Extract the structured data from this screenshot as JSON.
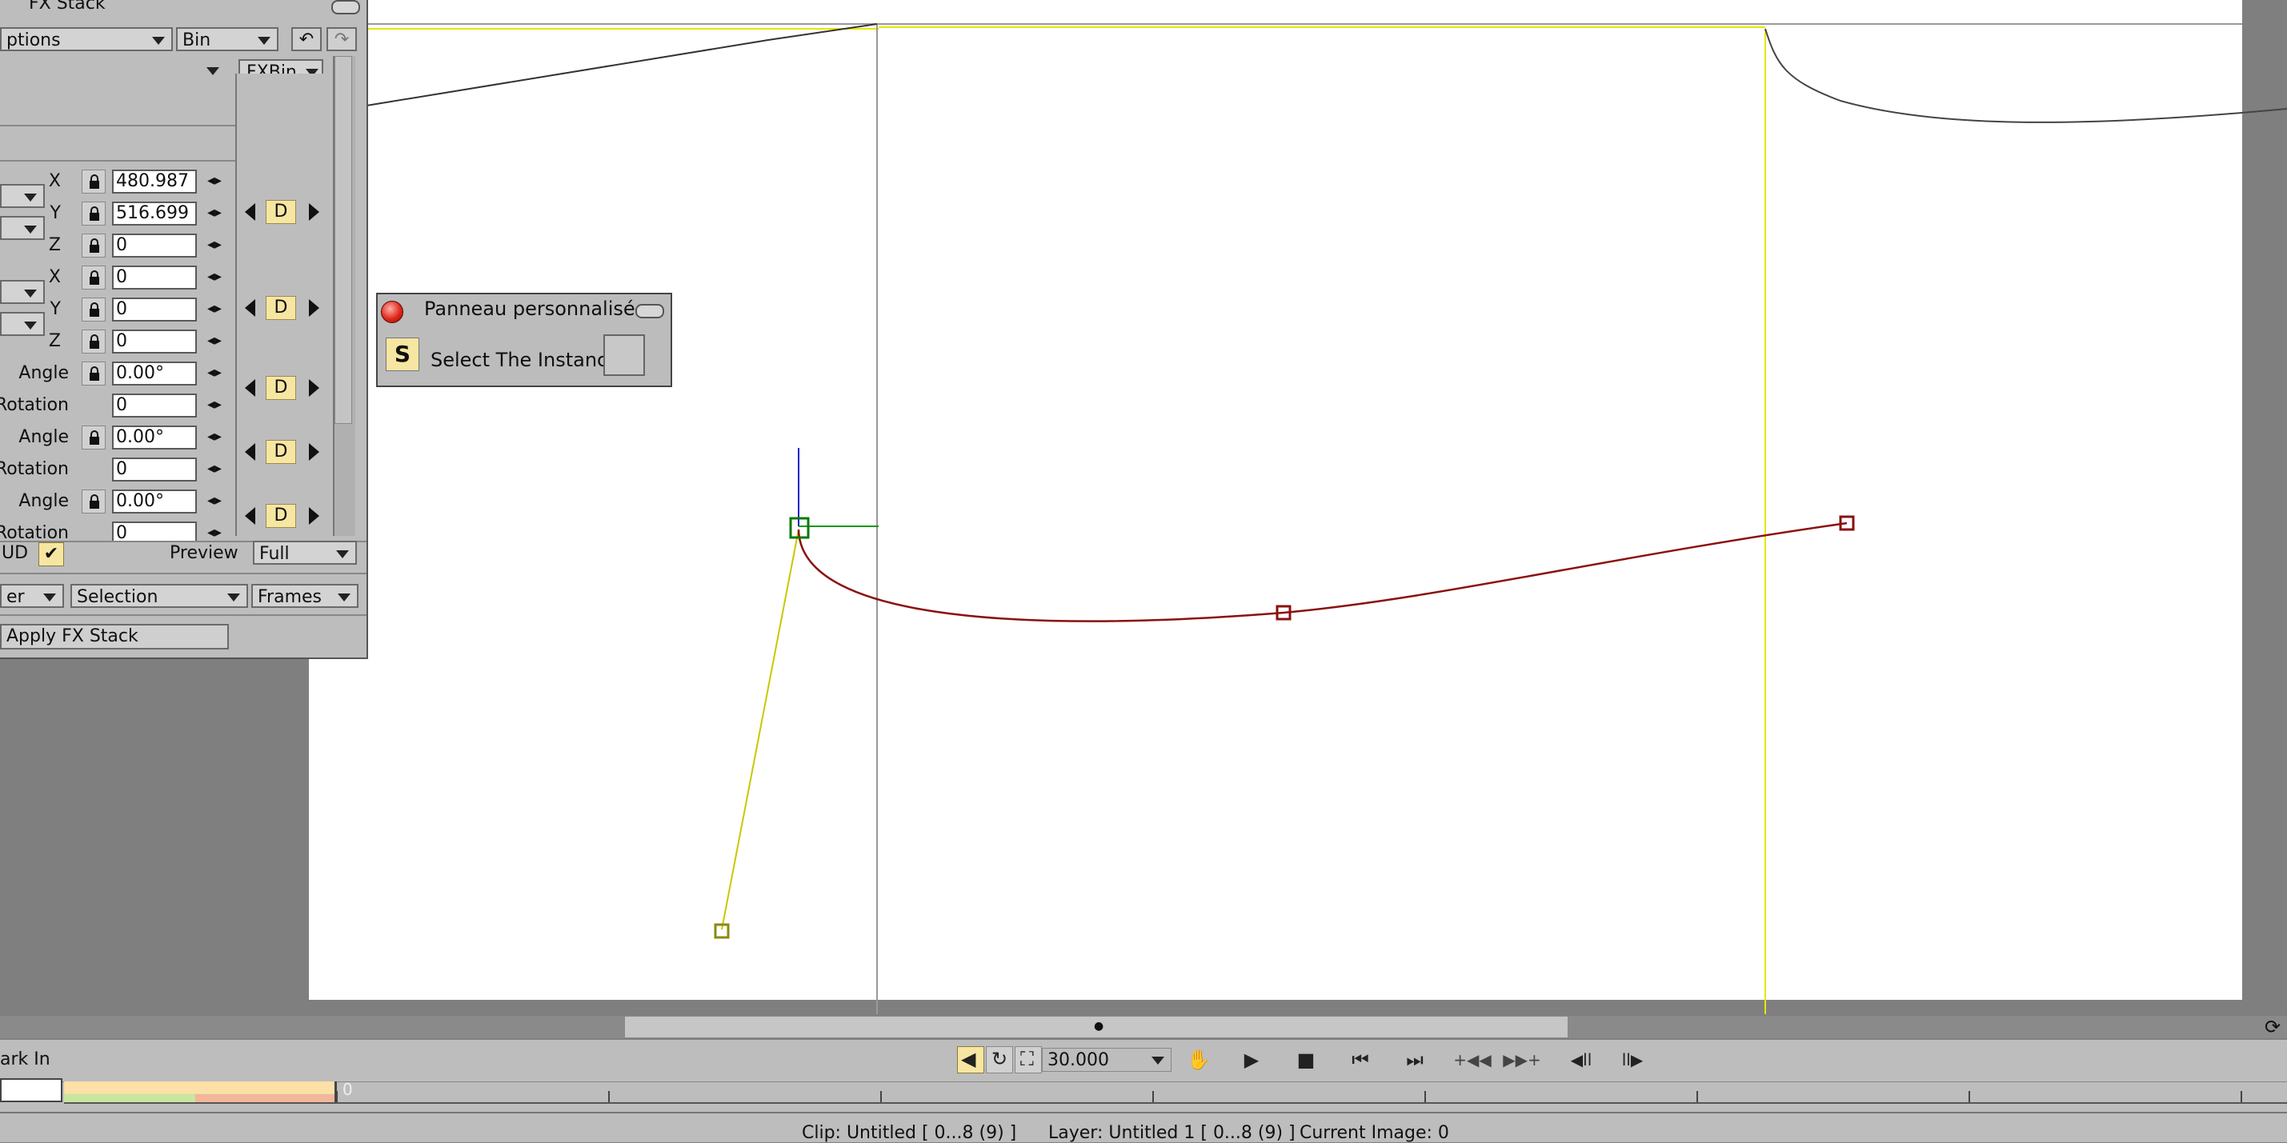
{
  "window": {
    "title": "FX Stack"
  },
  "fx_panel": {
    "options_label": "ptions",
    "bin_label": "Bin",
    "fxbin_label": "FXBin",
    "params": [
      {
        "label": "X",
        "value": "480.987"
      },
      {
        "label": "Y",
        "value": "516.699"
      },
      {
        "label": "Z",
        "value": "0"
      },
      {
        "label": "X",
        "value": "0"
      },
      {
        "label": "Y",
        "value": "0"
      },
      {
        "label": "Z",
        "value": "0"
      },
      {
        "label": "Angle",
        "value": "0.00°"
      },
      {
        "label": "Rotation",
        "value": "0"
      },
      {
        "label": "Angle",
        "value": "0.00°"
      },
      {
        "label": "Rotation",
        "value": "0"
      },
      {
        "label": "Angle",
        "value": "0.00°"
      },
      {
        "label": "Rotation",
        "value": "0"
      }
    ],
    "keyframe_label": "D",
    "hud_label": "UD",
    "preview_label": "Preview",
    "preview_value": "Full",
    "render_dropdown_left": "er",
    "selection_label": "Selection",
    "frames_label": "Frames",
    "apply_button": "Apply FX Stack"
  },
  "custom_panel": {
    "title": "Panneau personnalisé",
    "s_label": "S",
    "select_instance_label": "Select The Instance"
  },
  "transport": {
    "mark_in_label": "ark In",
    "fps_value": "30.000"
  },
  "timeline": {
    "current_frame_label": "0"
  },
  "status": {
    "clip": "Clip: Untitled [ 0...8  (9) ]",
    "layer": "Layer: Untitled 1 [ 0...8  (9) ]",
    "current_image": "Current Image: 0"
  },
  "colors": {
    "panel_bg": "#bdbdbd",
    "keyframe_bg": "#f7e6a2",
    "spline_red": "#8b1010",
    "guide_yellow": "#e6e600",
    "handle_green": "#0a7a0a"
  }
}
